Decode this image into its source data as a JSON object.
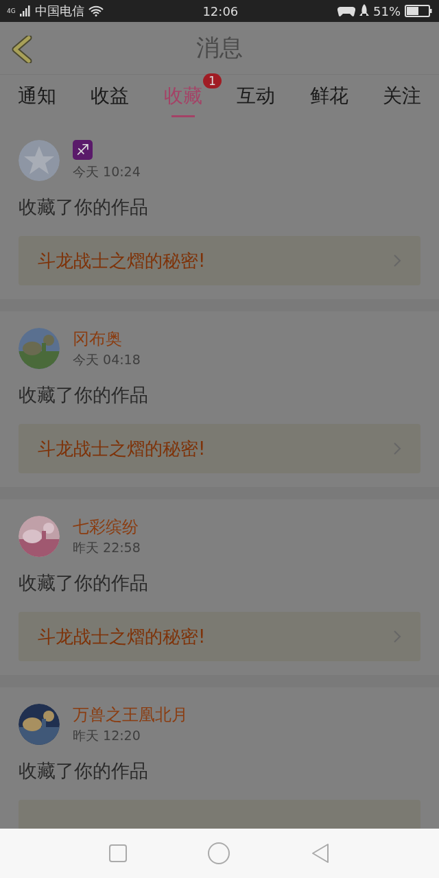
{
  "status_bar": {
    "network": "4G",
    "carrier": "中国电信",
    "time": "12:06",
    "battery": "51%"
  },
  "header": {
    "title": "消息"
  },
  "tabs": [
    {
      "label": "通知",
      "selected": false
    },
    {
      "label": "收益",
      "selected": false
    },
    {
      "label": "收藏",
      "selected": true,
      "badge": "1"
    },
    {
      "label": "互动",
      "selected": false
    },
    {
      "label": "鲜花",
      "selected": false
    },
    {
      "label": "关注",
      "selected": false
    }
  ],
  "messages": [
    {
      "kind": "symbol",
      "name": "♐",
      "time": "今天 10:24",
      "action": "收藏了你的作品",
      "work": "斗龙战士之熠的秘密!"
    },
    {
      "kind": "user",
      "name": "冈布奥",
      "time": "今天 04:18",
      "action": "收藏了你的作品",
      "work": "斗龙战士之熠的秘密!"
    },
    {
      "kind": "user",
      "name": "七彩缤纷",
      "time": "昨天 22:58",
      "action": "收藏了你的作品",
      "work": "斗龙战士之熠的秘密!"
    },
    {
      "kind": "user",
      "name": "万兽之王凰北月",
      "time": "昨天 12:20",
      "action": "收藏了你的作品"
    }
  ]
}
